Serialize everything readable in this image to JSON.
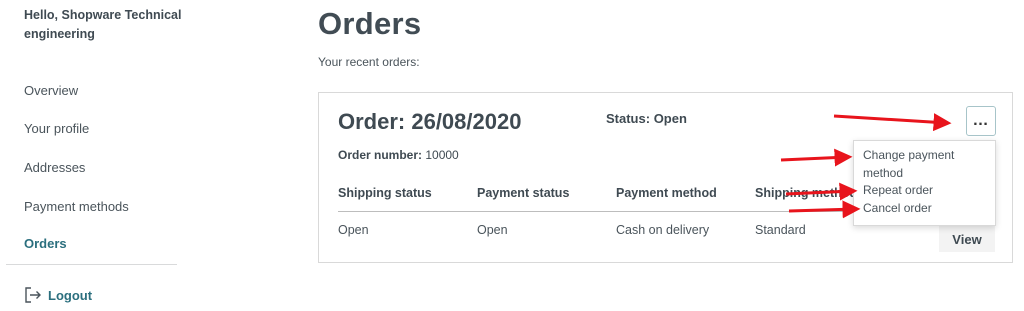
{
  "sidebar": {
    "greeting": "Hello, Shopware Technical engineering",
    "items": [
      {
        "label": "Overview"
      },
      {
        "label": "Your profile"
      },
      {
        "label": "Addresses"
      },
      {
        "label": "Payment methods"
      },
      {
        "label": "Orders"
      }
    ],
    "logout_label": "Logout"
  },
  "main": {
    "title": "Orders",
    "subtitle": "Your recent orders:"
  },
  "order": {
    "heading": "Order: 26/08/2020",
    "status_label": "Status:",
    "status_value": "Open",
    "number_label": "Order number:",
    "number_value": "10000",
    "columns": [
      "Shipping status",
      "Payment status",
      "Payment method",
      "Shipping method"
    ],
    "row": [
      "Open",
      "Open",
      "Cash on delivery",
      "Standard"
    ],
    "view_label": "View",
    "more_label": "…"
  },
  "dropdown": {
    "items": [
      {
        "label": "Change payment method"
      },
      {
        "label": "Repeat order"
      },
      {
        "label": "Cancel order"
      }
    ]
  },
  "colors": {
    "accent": "#2b6f7e",
    "annotation_arrow": "#e8141c"
  }
}
